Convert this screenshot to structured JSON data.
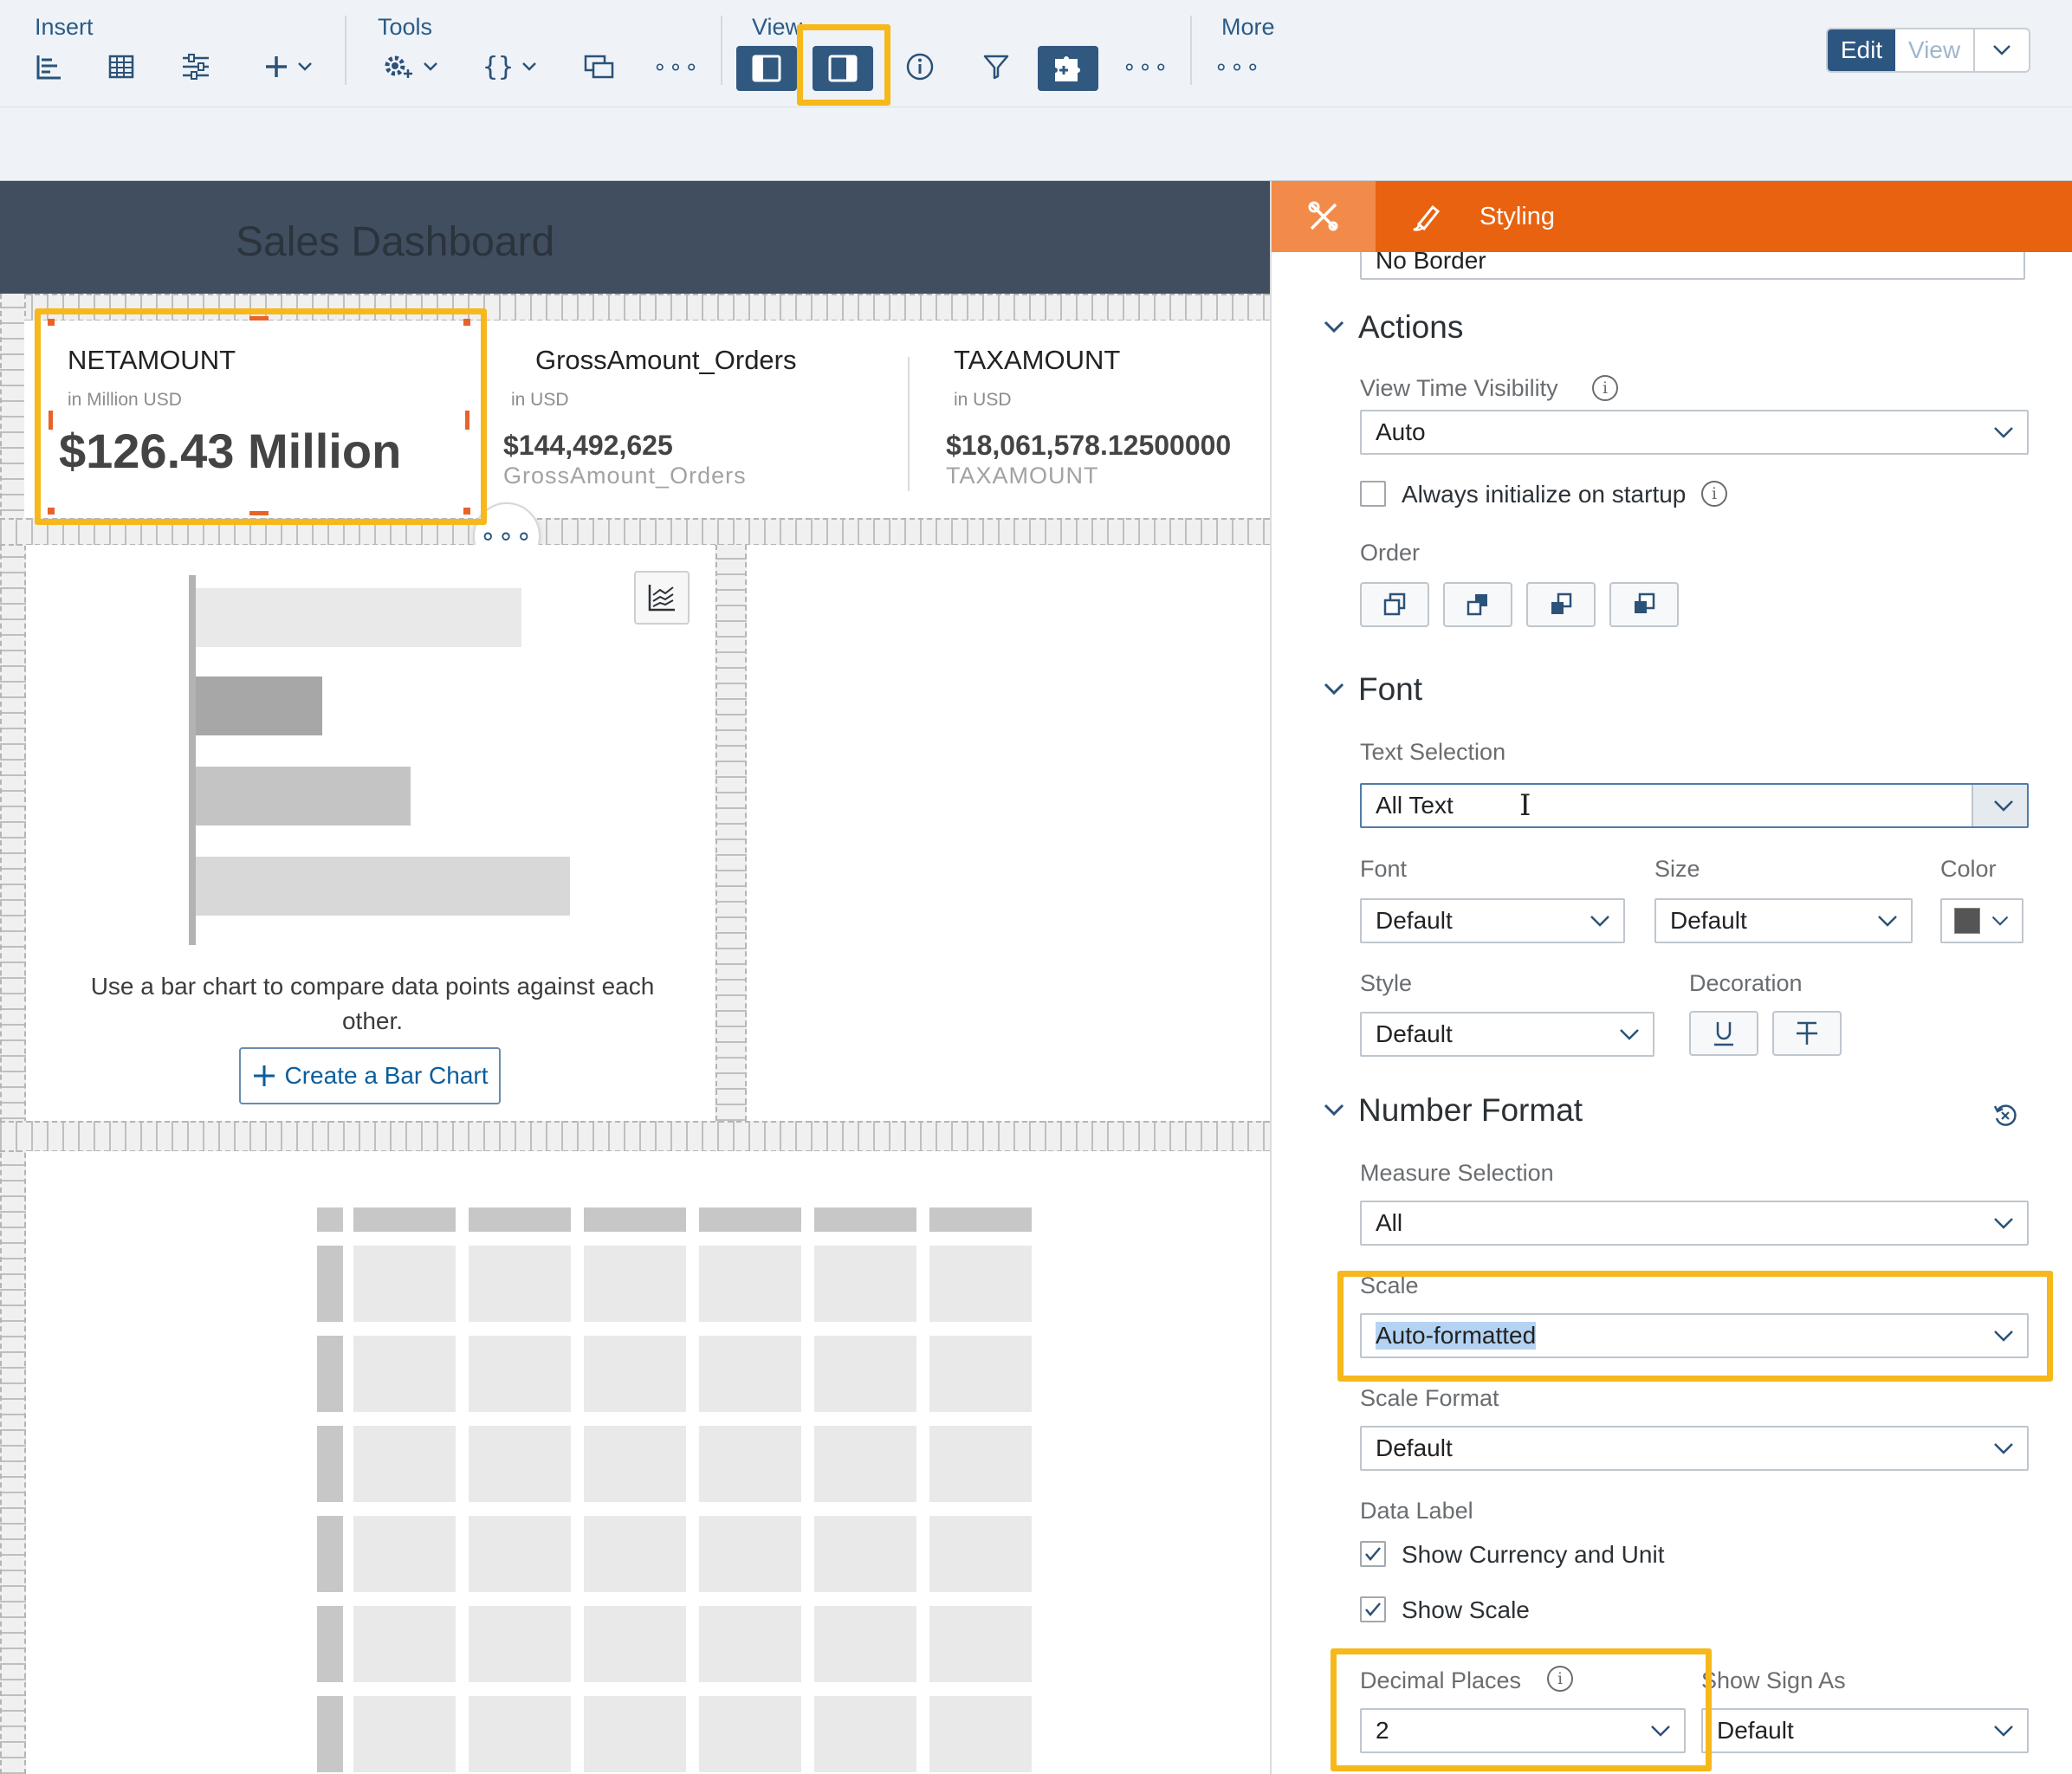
{
  "toolbar": {
    "insert_label": "Insert",
    "tools_label": "Tools",
    "view_label": "View",
    "more_label": "More",
    "edit_label": "Edit",
    "view_mode_label": "View"
  },
  "dashboard": {
    "title": "Sales Dashboard",
    "kpis": [
      {
        "title": "NETAMOUNT",
        "subtitle": "in Million USD",
        "value": "$126.43 Million",
        "caption": ""
      },
      {
        "title": "GrossAmount_Orders",
        "subtitle": "in USD",
        "value": "$144,492,625",
        "caption": "GrossAmount_Orders"
      },
      {
        "title": "TAXAMOUNT",
        "subtitle": "in USD",
        "value": "$18,061,578.12500000",
        "caption": "TAXAMOUNT"
      }
    ],
    "chart_placeholder": {
      "caption": "Use a bar chart to compare data points against each other.",
      "button_label": "Create a Bar Chart"
    }
  },
  "panel": {
    "header_label": "Styling",
    "cut_off_border_value": "No Border",
    "actions": {
      "section_title": "Actions",
      "view_time_visibility_label": "View Time Visibility",
      "view_time_visibility_value": "Auto",
      "always_init_label": "Always initialize on startup",
      "always_init_checked": false,
      "order_label": "Order"
    },
    "font": {
      "section_title": "Font",
      "text_selection_label": "Text Selection",
      "text_selection_value": "All Text",
      "font_label": "Font",
      "font_value": "Default",
      "size_label": "Size",
      "size_value": "Default",
      "color_label": "Color",
      "color_swatch": "#555555",
      "style_label": "Style",
      "style_value": "Default",
      "decoration_label": "Decoration"
    },
    "number_format": {
      "section_title": "Number Format",
      "measure_selection_label": "Measure Selection",
      "measure_selection_value": "All",
      "scale_label": "Scale",
      "scale_value": "Auto-formatted",
      "scale_format_label": "Scale Format",
      "scale_format_value": "Default",
      "data_label_label": "Data Label",
      "show_currency_label": "Show Currency and Unit",
      "show_currency_checked": true,
      "show_scale_label": "Show Scale",
      "show_scale_checked": true,
      "decimal_places_label": "Decimal Places",
      "decimal_places_value": "2",
      "show_sign_label": "Show Sign As",
      "show_sign_value": "Default"
    }
  },
  "colors": {
    "highlight": "#f6b81a",
    "panel_header": "#e8620f",
    "active_button": "#31587f",
    "dashboard_header": "#414e5f"
  }
}
